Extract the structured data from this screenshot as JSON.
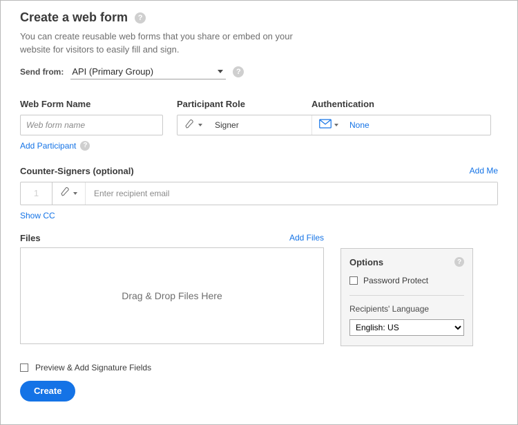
{
  "header": {
    "title": "Create a web form",
    "intro": "You can create reusable web forms that you share or embed on your website for visitors to easily fill and sign."
  },
  "sendFrom": {
    "label": "Send from:",
    "value": "API (Primary Group)"
  },
  "fields": {
    "name_label": "Web Form Name",
    "name_placeholder": "Web form name",
    "role_label": "Participant Role",
    "role_value": "Signer",
    "auth_label": "Authentication",
    "auth_value": "None",
    "add_participant": "Add Participant"
  },
  "counter": {
    "heading": "Counter-Signers (optional)",
    "add_me": "Add Me",
    "index": "1",
    "placeholder": "Enter recipient email",
    "show_cc": "Show CC"
  },
  "files": {
    "heading": "Files",
    "add_files": "Add Files",
    "drop_text": "Drag & Drop Files Here"
  },
  "options": {
    "heading": "Options",
    "password_protect": "Password Protect",
    "lang_label": "Recipients' Language",
    "lang_value": "English: US"
  },
  "footer": {
    "preview_label": "Preview & Add Signature Fields",
    "create_label": "Create"
  }
}
